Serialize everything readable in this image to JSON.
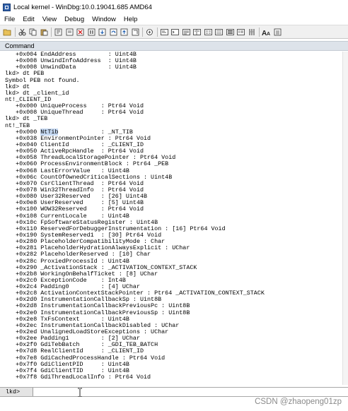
{
  "window": {
    "title": "Local kernel - WinDbg:10.0.19041.685 AMD64"
  },
  "menu": [
    "File",
    "Edit",
    "View",
    "Debug",
    "Window",
    "Help"
  ],
  "toolbar_icons": [
    "open-icon",
    "cut-icon",
    "copy-icon",
    "paste-icon",
    "go-icon",
    "restart-icon",
    "stop-debugging-icon",
    "break-icon",
    "step-into-icon",
    "step-over-icon",
    "step-out-icon",
    "run-to-cursor-icon",
    "source-mode-icon",
    "font-icon",
    "command-window-icon",
    "watch-window-icon",
    "locals-window-icon",
    "registers-window-icon",
    "memory-window-icon",
    "call-stack-icon",
    "disassembly-icon",
    "scratch-pad-icon",
    "font-size-icon",
    "options-icon"
  ],
  "panel": {
    "title": "Command"
  },
  "output_lines": [
    "   +0x004 EndAddress         : Uint4B",
    "   +0x008 UnwindInfoAddress  : Uint4B",
    "   +0x008 UnwindData         : Uint4B",
    "lkd> dt PEB",
    "Symbol PEB not found.",
    "lkd> dt",
    "lkd> dt _client_id",
    "nt!_CLIENT_ID",
    "   +0x000 UniqueProcess    : Ptr64 Void",
    "   +0x008 UniqueThread     : Ptr64 Void",
    "lkd> dt _TEB",
    "nt!_TEB",
    "   +0x000 NtTib            : _NT_TIB",
    "   +0x038 EnvironmentPointer : Ptr64 Void",
    "   +0x040 ClientId         : _CLIENT_ID",
    "   +0x050 ActiveRpcHandle  : Ptr64 Void",
    "   +0x058 ThreadLocalStoragePointer : Ptr64 Void",
    "   +0x060 ProcessEnvironmentBlock : Ptr64 _PEB",
    "   +0x068 LastErrorValue   : Uint4B",
    "   +0x06c CountOfOwnedCriticalSections : Uint4B",
    "   +0x070 CsrClientThread  : Ptr64 Void",
    "   +0x078 Win32ThreadInfo  : Ptr64 Void",
    "   +0x080 User32Reserved   : [26] Uint4B",
    "   +0x0e8 UserReserved     : [5] Uint4B",
    "   +0x100 WOW32Reserved    : Ptr64 Void",
    "   +0x108 CurrentLocale    : Uint4B",
    "   +0x10c FpSoftwareStatusRegister : Uint4B",
    "   +0x110 ReservedForDebuggerInstrumentation : [16] Ptr64 Void",
    "   +0x190 SystemReserved1  : [30] Ptr64 Void",
    "   +0x280 PlaceholderCompatibilityMode : Char",
    "   +0x281 PlaceholderHydrationAlwaysExplicit : UChar",
    "   +0x282 PlaceholderReserved : [10] Char",
    "   +0x28c ProxiedProcessId : Uint4B",
    "   +0x290 _ActivationStack : _ACTIVATION_CONTEXT_STACK",
    "   +0x2b8 WorkingOnBehalfTicket : [8] UChar",
    "   +0x2c0 ExceptionCode    : Int4B",
    "   +0x2c4 Padding0         : [4] UChar",
    "   +0x2c8 ActivationContextStackPointer : Ptr64 _ACTIVATION_CONTEXT_STACK",
    "   +0x2d0 InstrumentationCallbackSp : Uint8B",
    "   +0x2d8 InstrumentationCallbackPreviousPc : Uint8B",
    "   +0x2e0 InstrumentationCallbackPreviousSp : Uint8B",
    "   +0x2e8 TxFsContext      : Uint4B",
    "   +0x2ec InstrumentationCallbackDisabled : UChar",
    "   +0x2ed UnalignedLoadStoreExceptions : UChar",
    "   +0x2ee Padding1         : [2] UChar",
    "   +0x2f0 GdiTebBatch      : _GDI_TEB_BATCH",
    "   +0x7d8 RealClientId     : _CLIENT_ID",
    "   +0x7e8 GdiCachedProcessHandle : Ptr64 Void",
    "   +0x7f0 GdiClientPID     : Uint4B",
    "   +0x7f4 GdiClientTID     : Uint4B",
    "   +0x7f8 GdiThreadLocalInfo : Ptr64 Void"
  ],
  "highlight": {
    "line": 12,
    "text": "NtTib"
  },
  "command": {
    "prompt": "lkd>",
    "value": ""
  },
  "watermark": "CSDN @zhaopeng01zp"
}
